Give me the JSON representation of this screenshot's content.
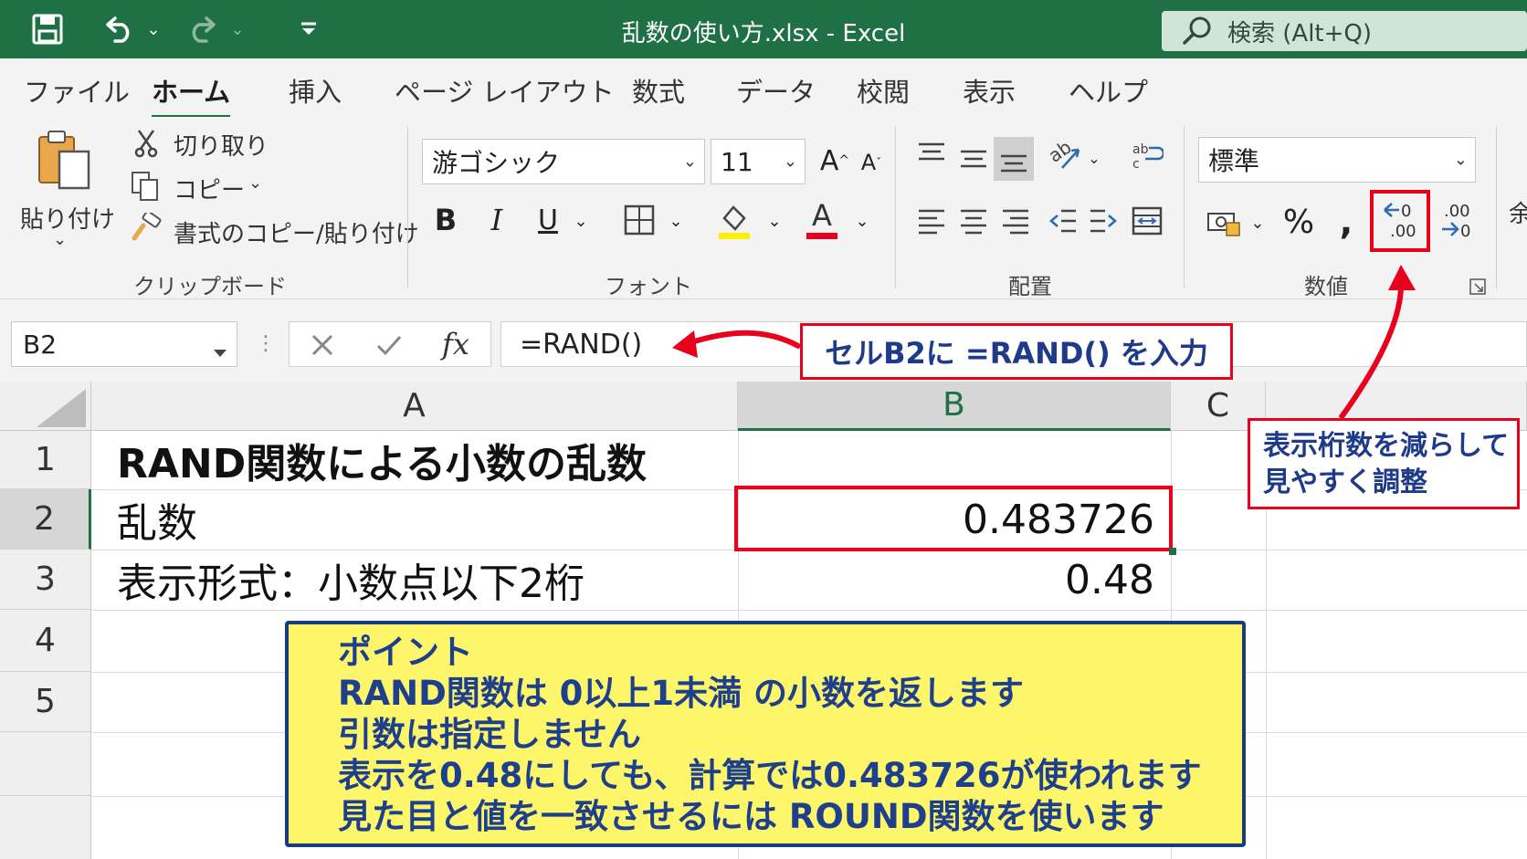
{
  "window": {
    "title": "乱数の使い方.xlsx  -  Excel",
    "search_placeholder": "検索 (Alt+Q)",
    "titlebar_color": "#1f7145"
  },
  "menu": {
    "tabs": [
      "ファイル",
      "ホーム",
      "挿入",
      "ページ レイアウト",
      "数式",
      "データ",
      "校閲",
      "表示",
      "ヘルプ"
    ],
    "active": "ホーム"
  },
  "ribbon": {
    "clipboard": {
      "paste": "貼り付け",
      "cut": "切り取り",
      "copy": "コピー",
      "format_painter": "書式のコピー/貼り付け",
      "group": "クリップボード"
    },
    "font": {
      "family": "游ゴシック",
      "size": "11",
      "group": "フォント"
    },
    "alignment": {
      "group": "配置"
    },
    "number": {
      "format": "標準",
      "group": "数値"
    },
    "partial_cut": "余"
  },
  "formula_bar": {
    "name_box": "B2",
    "formula": "=RAND()"
  },
  "sheet": {
    "columns": [
      "A",
      "B",
      "C"
    ],
    "rows": [
      "1",
      "2",
      "3",
      "4",
      "5"
    ],
    "cells": {
      "A1": "RAND関数による小数の乱数",
      "A2": "乱数",
      "B2": "0.483726",
      "A3": "表示形式：小数点以下2桁",
      "B3": "0.48"
    }
  },
  "annotations": {
    "formula_note": "セルB2に =RAND() を入力",
    "decimal_note": [
      "表示桁数を減らして",
      "見やすく調整"
    ],
    "point_title": "ポイント",
    "point_lines": [
      "RAND関数は 0以上1未満 の小数を返します",
      "引数は指定しません",
      "表示を0.48にしても、計算では0.483726が使われます",
      "見た目と値を一致させるには ROUND関数を使います"
    ],
    "accent_red": "#e8001c",
    "note_blue": "#1e3a8a",
    "point_bg": "#fdf66b"
  }
}
